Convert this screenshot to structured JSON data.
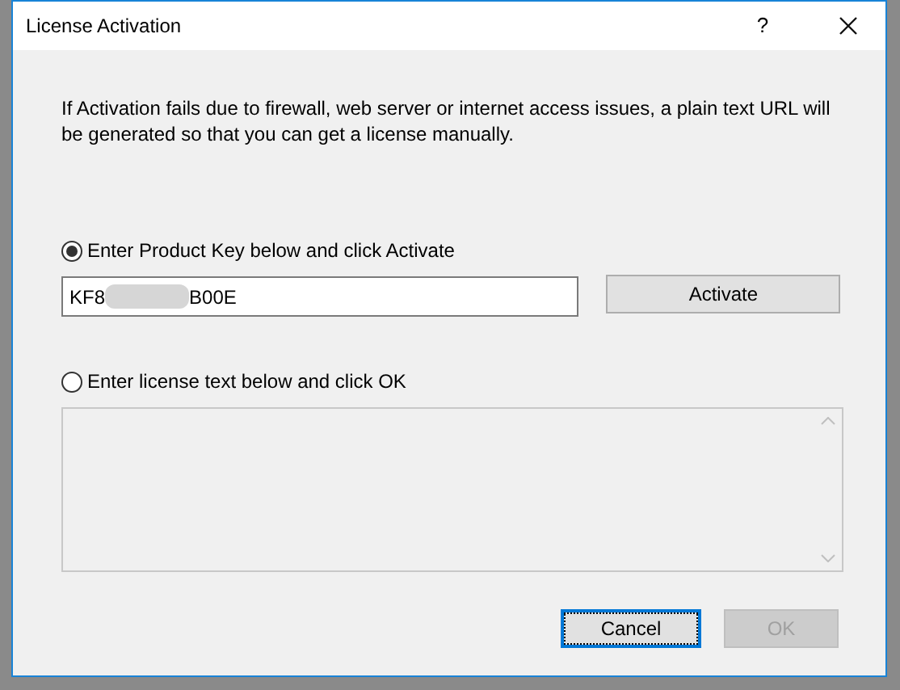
{
  "window": {
    "title": "License Activation",
    "help": "?"
  },
  "description": "If Activation fails due to firewall, web server or internet access issues, a plain text URL will be generated so that you can get a license manually.",
  "options": [
    {
      "label": "Enter Product Key below and click Activate",
      "selected": true
    },
    {
      "label": "Enter license text below and click OK",
      "selected": false
    }
  ],
  "product_key": {
    "value_start": "KF8",
    "value_end": "B00E",
    "redacted": true
  },
  "activate_button": {
    "label": "Activate",
    "disabled": false
  },
  "buttons": [
    {
      "label": "Cancel",
      "disabled": false,
      "focused": true
    },
    {
      "label": "OK",
      "disabled": true,
      "focused": false
    }
  ]
}
